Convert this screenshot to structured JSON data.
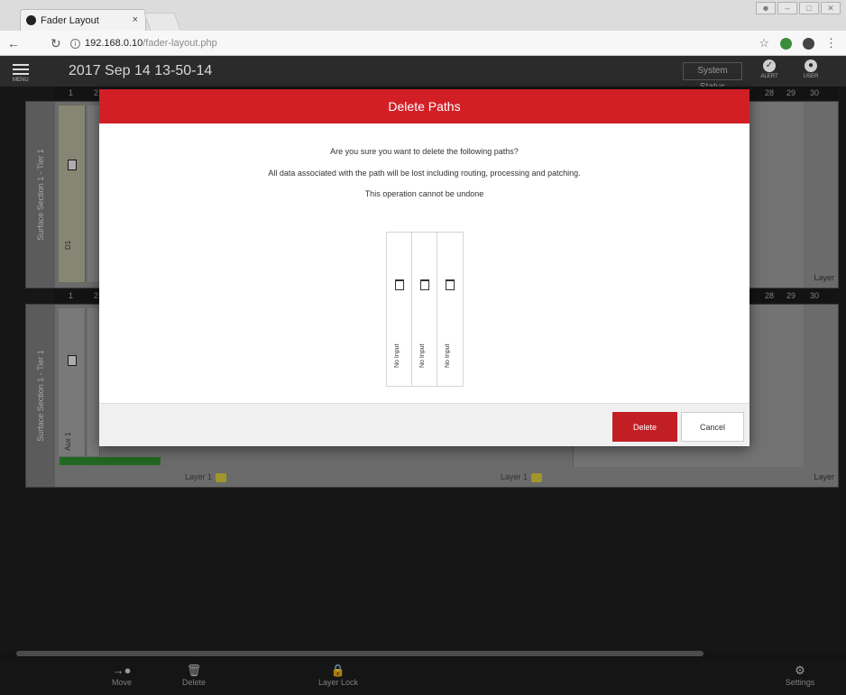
{
  "browser": {
    "tab_title": "Fader Layout",
    "tab_close": "×",
    "url_host": "192.168.0.10",
    "url_path": "/fader-layout.php"
  },
  "app": {
    "menu_label": "MENU",
    "title": "2017 Sep 14 13-50-14",
    "system_status": "System Status",
    "alert_label": "ALERT",
    "user_label": "USER"
  },
  "channel_numbers": {
    "top_left": [
      "1",
      "2"
    ],
    "top_right": [
      "28",
      "29",
      "30"
    ],
    "bottom_left": [
      "1",
      "2"
    ],
    "bottom_right": [
      "28",
      "29",
      "30"
    ]
  },
  "surface": {
    "section_top_label": "Surface Section 1 - Tier 1",
    "section_bottom_label": "Surface Section 1 - Tier 1",
    "strip_top_name": "D1",
    "strip_bottom_name": "Aux 1",
    "layer_right_top": "Layer",
    "layer_bottom_left": "Layer 1",
    "layer_bottom_mid": "Layer 1",
    "layer_bottom_right": "Layer"
  },
  "modal": {
    "title": "Delete Paths",
    "line1": "Are you sure you want to delete the following paths?",
    "line2": "All data associated with the path will be lost including routing, processing and patching.",
    "line3": "This operation cannot be undone",
    "paths": [
      "No Input",
      "No Input",
      "No Input"
    ],
    "delete_label": "Delete",
    "cancel_label": "Cancel"
  },
  "footer": {
    "move": "Move",
    "delete": "Delete",
    "layer_lock": "Layer Lock",
    "settings": "Settings"
  },
  "colors": {
    "accent": "#d21f26",
    "ok_green": "#2e8a2e",
    "layer_yellow": "#d6c83a"
  }
}
